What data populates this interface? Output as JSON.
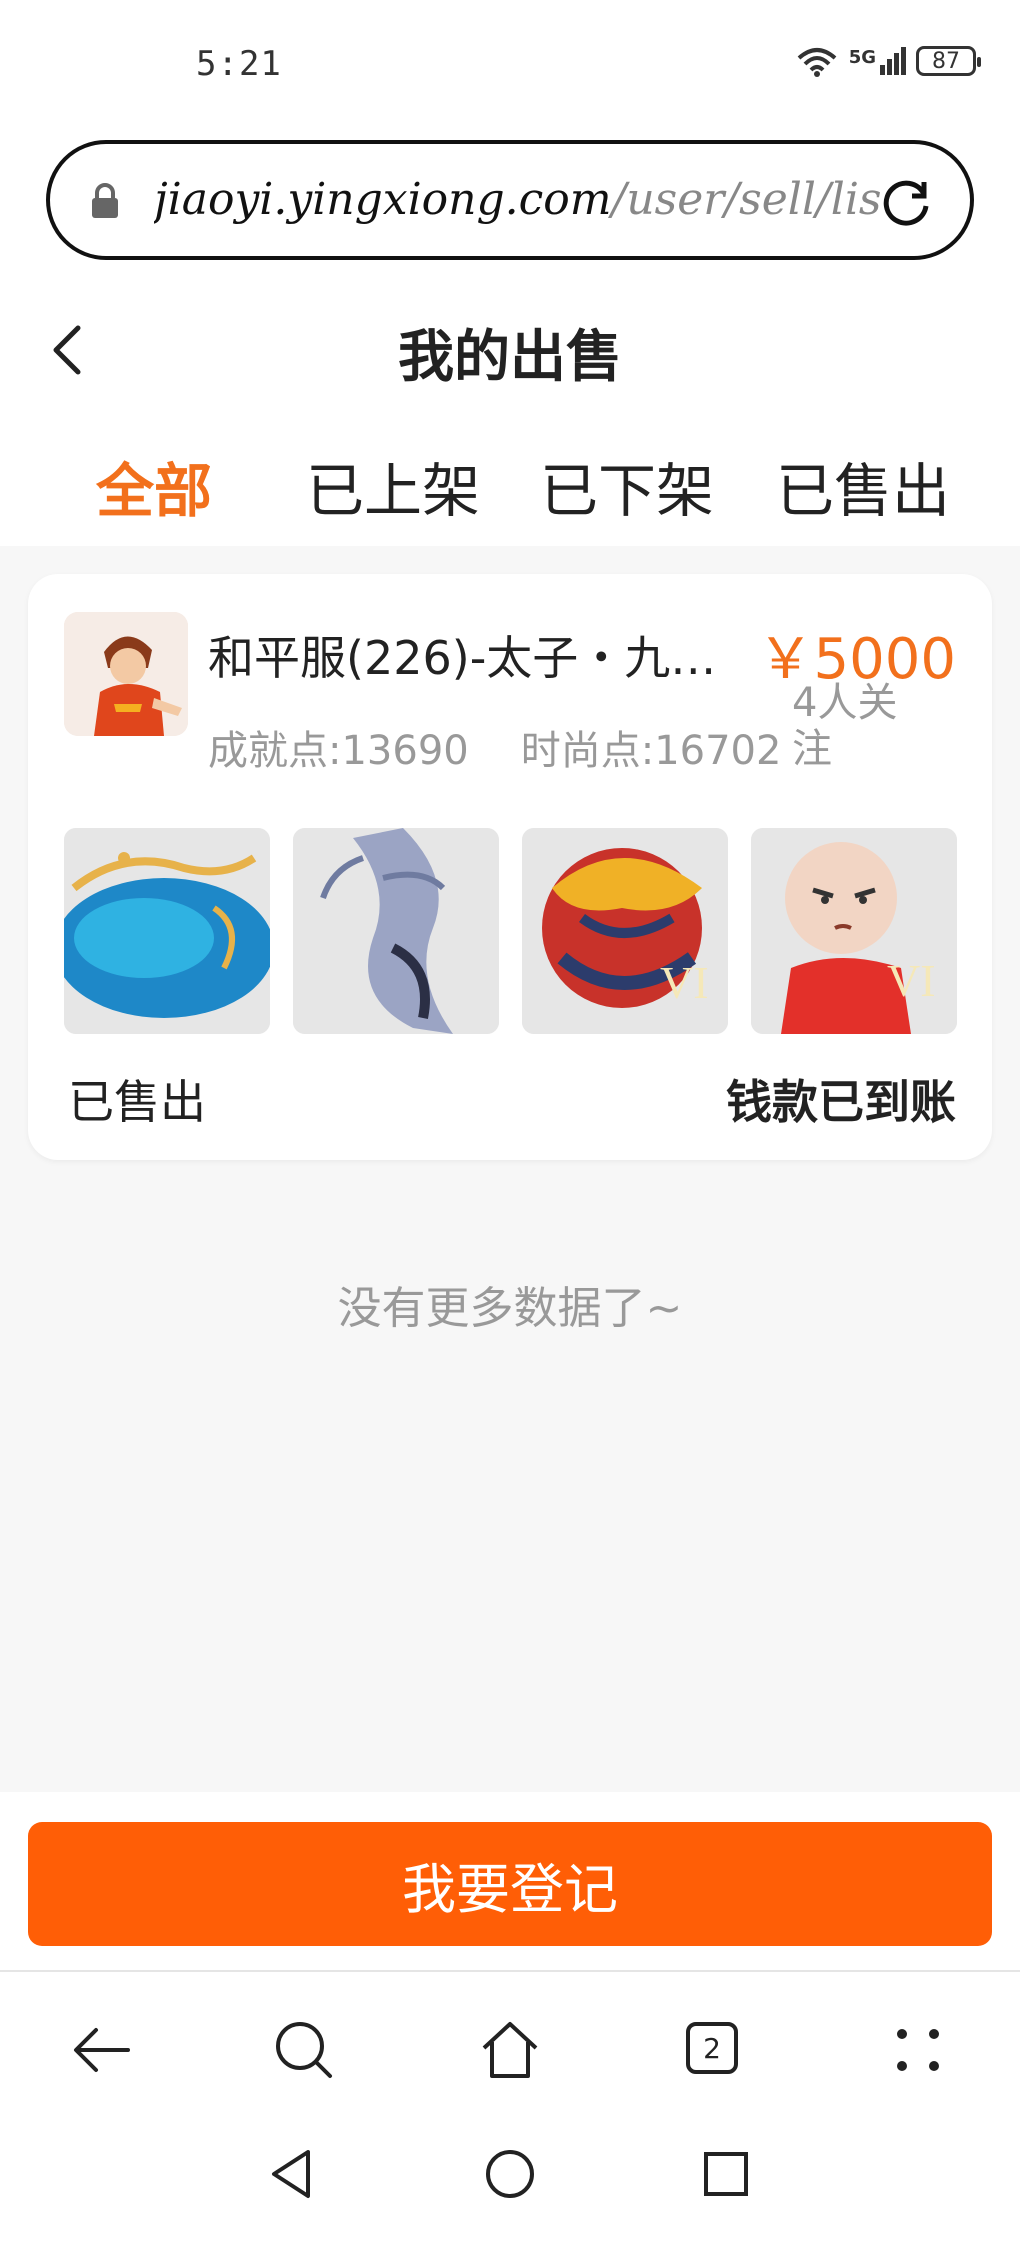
{
  "status_bar": {
    "time": "5:21",
    "network": "5G",
    "battery": "87"
  },
  "url_bar": {
    "host": "jiaoyi.yingxiong.com",
    "path": "/user/sell/lis"
  },
  "header": {
    "title": "我的出售"
  },
  "tabs": [
    {
      "label": "全部",
      "active": true
    },
    {
      "label": "已上架",
      "active": false
    },
    {
      "label": "已下架",
      "active": false
    },
    {
      "label": "已售出",
      "active": false
    }
  ],
  "listing": {
    "title": "和平服(226)-太子・九…",
    "price": "￥5000",
    "followers": "4人关注",
    "achievement_points": "成就点:13690",
    "fashion_points": "时尚点:16702",
    "sale_status": "已售出",
    "payout_status": "钱款已到账",
    "thumb_badges": [
      "",
      "",
      "VI",
      "VI"
    ]
  },
  "empty_hint": "没有更多数据了~",
  "register_button": "我要登记",
  "browser_nav": {
    "tab_count": "2"
  },
  "colors": {
    "accent": "#f2701c",
    "button": "#ff5e06"
  }
}
